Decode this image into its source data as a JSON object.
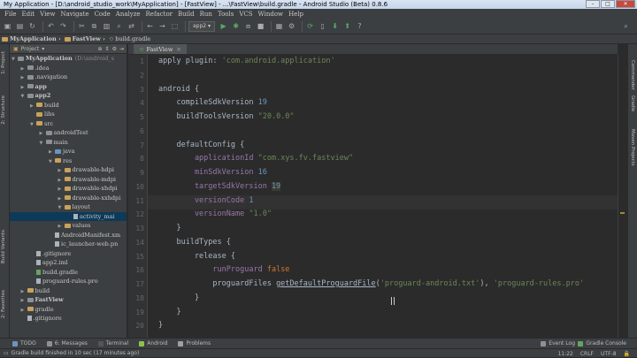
{
  "window": {
    "title": "My Application - [D:\\android_studio_work\\MyApplication] - [FastView] - ...\\FastView\\build.gradle - Android Studio (Beta) 0.8.6"
  },
  "menu": [
    "File",
    "Edit",
    "View",
    "Navigate",
    "Code",
    "Analyze",
    "Refactor",
    "Build",
    "Run",
    "Tools",
    "VCS",
    "Window",
    "Help"
  ],
  "toolbar": {
    "run_config": "app2"
  },
  "breadcrumbs": [
    "MyApplication",
    "FastView",
    "build.gradle"
  ],
  "project_panel": {
    "view_mode": "Project",
    "tree": [
      {
        "label": "MyApplication",
        "suffix": "(D:\\android_s",
        "depth": 0,
        "expanded": true,
        "icon": "folder-grey",
        "bold": true
      },
      {
        "label": ".idea",
        "depth": 1,
        "expanded": false,
        "icon": "folder-grey"
      },
      {
        "label": ".navigation",
        "depth": 1,
        "expanded": false,
        "icon": "folder-grey"
      },
      {
        "label": "app",
        "depth": 1,
        "expanded": false,
        "icon": "folder-grey",
        "bold": true
      },
      {
        "label": "app2",
        "depth": 1,
        "expanded": true,
        "icon": "folder-grey",
        "bold": true
      },
      {
        "label": "build",
        "depth": 2,
        "expanded": false,
        "icon": "folder-gold"
      },
      {
        "label": "libs",
        "depth": 2,
        "leaf": true,
        "icon": "folder-gold"
      },
      {
        "label": "src",
        "depth": 2,
        "expanded": true,
        "icon": "folder-gold"
      },
      {
        "label": "androidTest",
        "depth": 3,
        "expanded": false,
        "icon": "folder-grey"
      },
      {
        "label": "main",
        "depth": 3,
        "expanded": true,
        "icon": "folder-grey"
      },
      {
        "label": "java",
        "depth": 4,
        "expanded": false,
        "icon": "folder-blue"
      },
      {
        "label": "res",
        "depth": 4,
        "expanded": true,
        "icon": "folder-gold"
      },
      {
        "label": "drawable-hdpi",
        "depth": 5,
        "expanded": false,
        "icon": "folder-gold"
      },
      {
        "label": "drawable-mdpi",
        "depth": 5,
        "expanded": false,
        "icon": "folder-gold"
      },
      {
        "label": "drawable-xhdpi",
        "depth": 5,
        "expanded": false,
        "icon": "folder-gold"
      },
      {
        "label": "drawable-xxhdpi",
        "depth": 5,
        "expanded": false,
        "icon": "folder-gold"
      },
      {
        "label": "layout",
        "depth": 5,
        "expanded": true,
        "icon": "folder-gold"
      },
      {
        "label": "activity_mai",
        "depth": 6,
        "leaf": true,
        "icon": "file",
        "selected": true
      },
      {
        "label": "values",
        "depth": 5,
        "expanded": false,
        "icon": "folder-gold"
      },
      {
        "label": "AndroidManifest.xm",
        "depth": 4,
        "leaf": true,
        "icon": "file"
      },
      {
        "label": "ic_launcher-web.pn",
        "depth": 4,
        "leaf": true,
        "icon": "file"
      },
      {
        "label": ".gitignore",
        "depth": 2,
        "leaf": true,
        "icon": "file"
      },
      {
        "label": "app2.iml",
        "depth": 2,
        "leaf": true,
        "icon": "file"
      },
      {
        "label": "build.gradle",
        "depth": 2,
        "leaf": true,
        "icon": "file-green"
      },
      {
        "label": "proguard-rules.pro",
        "depth": 2,
        "leaf": true,
        "icon": "file"
      },
      {
        "label": "build",
        "depth": 1,
        "expanded": false,
        "icon": "folder-gold"
      },
      {
        "label": "FastView",
        "depth": 1,
        "expanded": false,
        "icon": "folder-grey",
        "bold": true
      },
      {
        "label": "gradle",
        "depth": 1,
        "expanded": false,
        "icon": "folder-gold"
      },
      {
        "label": ".gitignore",
        "depth": 1,
        "leaf": true,
        "icon": "file"
      }
    ]
  },
  "left_tool_tabs": [
    "1: Project",
    "2: Structure",
    "Build Variants",
    "2: Favorites"
  ],
  "right_tool_tabs": [
    "Commander",
    "Gradle",
    "Maven Projects"
  ],
  "editor": {
    "tab": "FastView",
    "current_line": 11,
    "lines": [
      {
        "n": 1,
        "segs": [
          [
            "apply plugin: ",
            "#a9b7c6"
          ],
          [
            "'com.android.application'",
            "#6a8759"
          ]
        ]
      },
      {
        "n": 2,
        "segs": []
      },
      {
        "n": 3,
        "segs": [
          [
            "android {",
            "#a9b7c6"
          ]
        ]
      },
      {
        "n": 4,
        "segs": [
          [
            "    compileSdkVersion ",
            "#a9b7c6"
          ],
          [
            "19",
            "#6897bb"
          ]
        ]
      },
      {
        "n": 5,
        "segs": [
          [
            "    buildToolsVersion ",
            "#a9b7c6"
          ],
          [
            "\"20.0.0\"",
            "#6a8759"
          ]
        ]
      },
      {
        "n": 6,
        "segs": []
      },
      {
        "n": 7,
        "segs": [
          [
            "    defaultConfig {",
            "#a9b7c6"
          ]
        ]
      },
      {
        "n": 8,
        "segs": [
          [
            "        applicationId ",
            "#9876aa"
          ],
          [
            "\"com.xys.fv.fastview\"",
            "#6a8759"
          ]
        ]
      },
      {
        "n": 9,
        "segs": [
          [
            "        minSdkVersion ",
            "#9876aa"
          ],
          [
            "16",
            "#6897bb"
          ]
        ]
      },
      {
        "n": 10,
        "segs": [
          [
            "        targetSdkVersion ",
            "#9876aa"
          ],
          [
            "19",
            "#6897bb"
          ]
        ]
      },
      {
        "n": 11,
        "segs": [
          [
            "        versionCode ",
            "#9876aa"
          ],
          [
            "1",
            "#6897bb"
          ]
        ]
      },
      {
        "n": 12,
        "segs": [
          [
            "        versionName ",
            "#9876aa"
          ],
          [
            "\"1.0\"",
            "#6a8759"
          ]
        ]
      },
      {
        "n": 13,
        "segs": [
          [
            "    }",
            "#a9b7c6"
          ]
        ]
      },
      {
        "n": 14,
        "segs": [
          [
            "    buildTypes {",
            "#a9b7c6"
          ]
        ]
      },
      {
        "n": 15,
        "segs": [
          [
            "        release {",
            "#a9b7c6"
          ]
        ]
      },
      {
        "n": 16,
        "segs": [
          [
            "            runProguard ",
            "#9876aa"
          ],
          [
            "false",
            "#cc7832"
          ]
        ]
      },
      {
        "n": 17,
        "segs": [
          [
            "            proguardFiles ",
            "#a9b7c6"
          ],
          [
            "getDefaultProguardFile",
            "#a9b7c6"
          ],
          [
            "(",
            "#a9b7c6"
          ],
          [
            "'proguard-android.txt'",
            "#6a8759"
          ],
          [
            "), ",
            "#a9b7c6"
          ],
          [
            "'proguard-rules.pro'",
            "#6a8759"
          ]
        ]
      },
      {
        "n": 18,
        "segs": [
          [
            "        }",
            "#a9b7c6"
          ]
        ]
      },
      {
        "n": 19,
        "segs": [
          [
            "    }",
            "#a9b7c6"
          ]
        ]
      },
      {
        "n": 20,
        "segs": [
          [
            "}",
            "#a9b7c6"
          ]
        ]
      }
    ]
  },
  "bottom_tabs": {
    "left": [
      "TODO",
      "6: Messages",
      "Terminal",
      "Android",
      "Problems"
    ],
    "right": [
      "Event Log",
      "Gradle Console"
    ]
  },
  "status": {
    "message": "Gradle build finished in 10 sec (17 minutes ago)",
    "position": "11:22",
    "line_sep": "CRLF",
    "encoding": "UTF-8"
  },
  "colors": {
    "background": "#2b2b2b",
    "panel": "#3c3f41",
    "selection": "#0d3a58",
    "keyword": "#cc7832",
    "string": "#6a8759",
    "number": "#6897bb",
    "property": "#9876aa"
  }
}
